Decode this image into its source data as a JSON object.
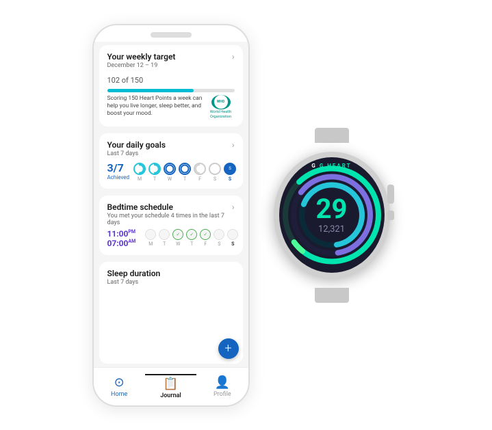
{
  "phone": {
    "weekly_target": {
      "title": "Your weekly target",
      "date_range": "December 12 – 19",
      "points": "102",
      "of_label": "of 150",
      "progress_pct": 68,
      "description": "Scoring 150 Heart Points a week can help you live longer, sleep better, and boost your mood.",
      "who_label": "World Health\nOrganization"
    },
    "daily_goals": {
      "title": "Your daily goals",
      "subtitle": "Last 7 days",
      "achieved": "3/7",
      "achieved_label": "Achieved",
      "days": [
        "M",
        "T",
        "W",
        "T",
        "F",
        "S",
        "S"
      ],
      "day_states": [
        "half",
        "half",
        "half",
        "full",
        "full",
        "empty",
        "today"
      ]
    },
    "bedtime": {
      "title": "Bedtime schedule",
      "subtitle": "You met your schedule 4 times in the last 7 days",
      "sleep_time": "11:00",
      "sleep_ampm": "PM",
      "wake_time": "07:00",
      "wake_ampm": "AM",
      "days": [
        "M",
        "T",
        "W",
        "T",
        "F",
        "S",
        "S"
      ],
      "checked": [
        false,
        false,
        true,
        true,
        true,
        false,
        false
      ]
    },
    "sleep_duration": {
      "title": "Sleep duration",
      "subtitle": "Last 7 days"
    },
    "fab_label": "+",
    "nav": {
      "home": "Home",
      "journal": "Journal",
      "profile": "Profile"
    }
  },
  "watch": {
    "label": "G HEART",
    "number": "29",
    "steps": "12,321",
    "ring_outer_color": "#00e5b0",
    "ring_mid_color": "#7c6fe0",
    "ring_inner_color": "#26c6da"
  }
}
